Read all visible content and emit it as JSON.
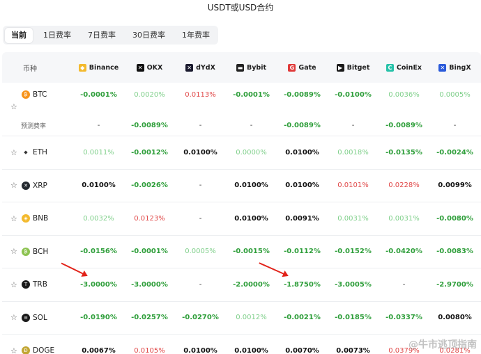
{
  "title": "USDT或USD合约",
  "tabs": [
    "当前",
    "1日费率",
    "7日费率",
    "30日费率",
    "1年费率"
  ],
  "header": {
    "coin_col": "币种",
    "exchanges": [
      {
        "name": "Binance",
        "icon": "binance-icon",
        "color": "#f3ba2f"
      },
      {
        "name": "OKX",
        "icon": "okx-icon",
        "color": "#111111"
      },
      {
        "name": "dYdX",
        "icon": "dydx-icon",
        "color": "#1a1a2e"
      },
      {
        "name": "Bybit",
        "icon": "bybit-icon",
        "color": "#222222"
      },
      {
        "name": "Gate",
        "icon": "gate-icon",
        "color": "#e03b3b"
      },
      {
        "name": "Bitget",
        "icon": "bitget-icon",
        "color": "#1a1a1a"
      },
      {
        "name": "CoinEx",
        "icon": "coinex-icon",
        "color": "#27c2a9"
      },
      {
        "name": "BingX",
        "icon": "bingx-icon",
        "color": "#2a5ada"
      }
    ]
  },
  "prediction_label": "预测费率",
  "rows": [
    {
      "symbol": "BTC",
      "icon_color": "#f7931a",
      "glyph": "₿",
      "values": [
        "-0.0001%",
        "0.0020%",
        "0.0113%",
        "-0.0001%",
        "-0.0089%",
        "-0.0100%",
        "0.0036%",
        "0.0005%"
      ],
      "styles": [
        "pos",
        "lpos",
        "neg",
        "pos",
        "pos",
        "pos",
        "lpos",
        "lpos"
      ],
      "prediction": [
        "-",
        "-0.0089%",
        "-",
        "-",
        "-0.0089%",
        "-",
        "-0.0089%",
        "-"
      ],
      "prediction_styles": [
        "dash",
        "pos",
        "dash",
        "dash",
        "pos",
        "dash",
        "pos",
        "dash"
      ]
    },
    {
      "symbol": "ETH",
      "icon_color": "#ffffff",
      "glyph": "◆",
      "values": [
        "0.0011%",
        "-0.0012%",
        "0.0100%",
        "0.0000%",
        "0.0100%",
        "0.0018%",
        "-0.0135%",
        "-0.0024%"
      ],
      "styles": [
        "lpos",
        "pos",
        "neu",
        "lpos",
        "neu",
        "lpos",
        "pos",
        "pos"
      ]
    },
    {
      "symbol": "XRP",
      "icon_color": "#23292f",
      "glyph": "✕",
      "values": [
        "0.0100%",
        "-0.0026%",
        "-",
        "0.0100%",
        "0.0100%",
        "0.0101%",
        "0.0228%",
        "0.0099%"
      ],
      "styles": [
        "neu",
        "pos",
        "dash",
        "neu",
        "neu",
        "neg",
        "neg",
        "neu"
      ]
    },
    {
      "symbol": "BNB",
      "icon_color": "#f3ba2f",
      "glyph": "◈",
      "values": [
        "0.0032%",
        "0.0123%",
        "-",
        "0.0100%",
        "0.0091%",
        "0.0031%",
        "0.0031%",
        "-0.0080%"
      ],
      "styles": [
        "lpos",
        "neg",
        "dash",
        "neu",
        "neu",
        "lpos",
        "lpos",
        "pos"
      ]
    },
    {
      "symbol": "BCH",
      "icon_color": "#8dc351",
      "glyph": "₿",
      "values": [
        "-0.0156%",
        "-0.0001%",
        "0.0005%",
        "-0.0015%",
        "-0.0112%",
        "-0.0152%",
        "-0.0420%",
        "-0.0083%"
      ],
      "styles": [
        "pos",
        "pos",
        "lpos",
        "pos",
        "pos",
        "pos",
        "pos",
        "pos"
      ]
    },
    {
      "symbol": "TRB",
      "icon_color": "#1a1a1a",
      "glyph": "T",
      "values": [
        "-3.0000%",
        "-3.0000%",
        "-",
        "-2.0000%",
        "-1.8750%",
        "-3.0005%",
        "-",
        "-2.9700%"
      ],
      "styles": [
        "pos",
        "pos",
        "dash",
        "pos",
        "pos",
        "pos",
        "dash",
        "pos"
      ]
    },
    {
      "symbol": "SOL",
      "icon_color": "#1a1a1a",
      "glyph": "≡",
      "values": [
        "-0.0190%",
        "-0.0257%",
        "-0.0270%",
        "0.0012%",
        "-0.0021%",
        "-0.0185%",
        "-0.0337%",
        "0.0080%"
      ],
      "styles": [
        "pos",
        "pos",
        "pos",
        "lpos",
        "pos",
        "pos",
        "pos",
        "neu"
      ]
    },
    {
      "symbol": "DOGE",
      "icon_color": "#c2a633",
      "glyph": "Ð",
      "values": [
        "0.0067%",
        "0.0105%",
        "0.0100%",
        "0.0100%",
        "0.0070%",
        "0.0073%",
        "0.0379%",
        "0.0281%"
      ],
      "styles": [
        "neu",
        "neg",
        "neu",
        "neu",
        "neu",
        "neu",
        "neg",
        "neg"
      ]
    }
  ],
  "watermark": "@牛市逃顶指南"
}
